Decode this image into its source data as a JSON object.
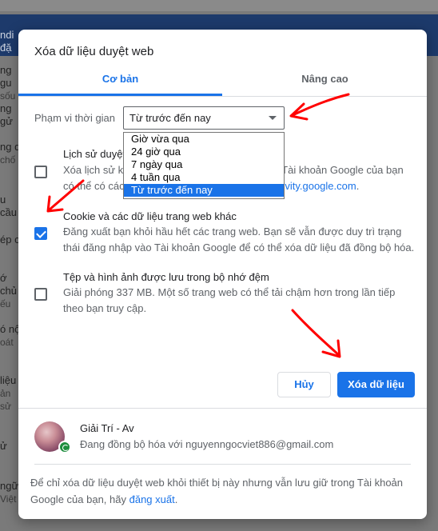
{
  "background": {
    "rows": [
      {
        "a": "ndi đặ",
        "b": ""
      },
      {
        "a": "ng gu",
        "b": "",
        "c": "sốu"
      },
      {
        "a": "ng gử",
        "b": ""
      },
      {
        "a": "ng di",
        "b": "chố"
      },
      {
        "a": "u cầu",
        "b": ""
      },
      {
        "a": "ép c",
        "b": ""
      },
      {
        "a": "ớ chủ",
        "b": "ếu"
      },
      {
        "a": "ó nội",
        "b": "oát"
      },
      {
        "a": "liệu",
        "b": "ản sử"
      },
      {
        "a": "ử",
        "b": ""
      },
      {
        "a": "ngữ",
        "b": "Việt"
      }
    ]
  },
  "dialog": {
    "title": "Xóa dữ liệu duyệt web",
    "tabs": [
      {
        "label": "Cơ bản",
        "active": true
      },
      {
        "label": "Nâng cao",
        "active": false
      }
    ],
    "time_range": {
      "label": "Phạm vi thời gian",
      "selected": "Từ trước đến nay",
      "options": [
        "Giờ vừa qua",
        "24 giờ qua",
        "7 ngày qua",
        "4 tuần qua",
        "Từ trước đến nay"
      ]
    },
    "items": [
      {
        "title": "Lịch sử duyệt",
        "desc_line1_left": "Xóa lịch sử k",
        "desc_line1_right": ". Tài khoản Google của bạn",
        "desc_line2_left": "có thể có các",
        "desc_line2_link": "yactivity.google.com",
        "desc_line2_end": ".",
        "checked": false
      },
      {
        "title": "Cookie và các dữ liệu trang web khác",
        "desc": "Đăng xuất bạn khỏi hầu hết các trang web. Bạn sẽ vẫn được duy trì trạng thái đăng nhập vào Tài khoản Google để có thể xóa dữ liệu đã đồng bộ hóa.",
        "checked": true
      },
      {
        "title": "Tệp và hình ảnh được lưu trong bộ nhớ đệm",
        "desc": "Giải phóng 337 MB. Một số trang web có thể tải chậm hơn trong lần tiếp theo bạn truy cập.",
        "checked": false
      }
    ],
    "buttons": {
      "cancel": "Hủy",
      "clear": "Xóa dữ liệu"
    },
    "account": {
      "name": "Giải Trí - Av",
      "sync_status": "Đang đồng bộ hóa với nguyenngocviet886@gmail.com"
    },
    "footer": {
      "text": "Để chỉ xóa dữ liệu duyệt web khỏi thiết bị này nhưng vẫn lưu giữ trong Tài khoản Google của bạn, hãy",
      "link": "đăng xuất",
      "end": "."
    }
  },
  "colors": {
    "accent": "#1a73e8",
    "annotation": "#ff0000",
    "sync_badge": "#1e8e3e"
  }
}
